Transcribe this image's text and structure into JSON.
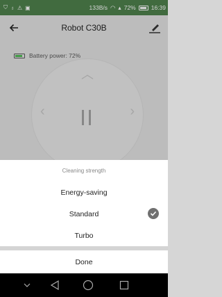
{
  "status_bar": {
    "speed": "133B/s",
    "battery": "72%",
    "time": "16:39"
  },
  "app_bar": {
    "title": "Robot C30B",
    "back_icon": "arrow-back-icon",
    "edit_icon": "edit-pen-icon"
  },
  "device": {
    "battery_label": "Battery power: 72%",
    "battery_level": 0.72
  },
  "controls": {
    "up_icon": "chevron-up-icon",
    "left_icon": "chevron-left-icon",
    "right_icon": "chevron-right-icon",
    "pause_icon": "pause-icon"
  },
  "sheet": {
    "header": "Cleaning strength",
    "options": [
      {
        "label": "Energy-saving",
        "selected": false
      },
      {
        "label": "Standard",
        "selected": true
      },
      {
        "label": "Turbo",
        "selected": false
      }
    ],
    "done_label": "Done"
  },
  "nav_bar": {
    "icons": [
      "chevron-down-icon",
      "back-triangle-icon",
      "home-circle-icon",
      "recents-square-icon"
    ]
  },
  "colors": {
    "status_bar": "#4a7a48",
    "battery_fill": "#4caf50",
    "check_bg": "#707070"
  }
}
